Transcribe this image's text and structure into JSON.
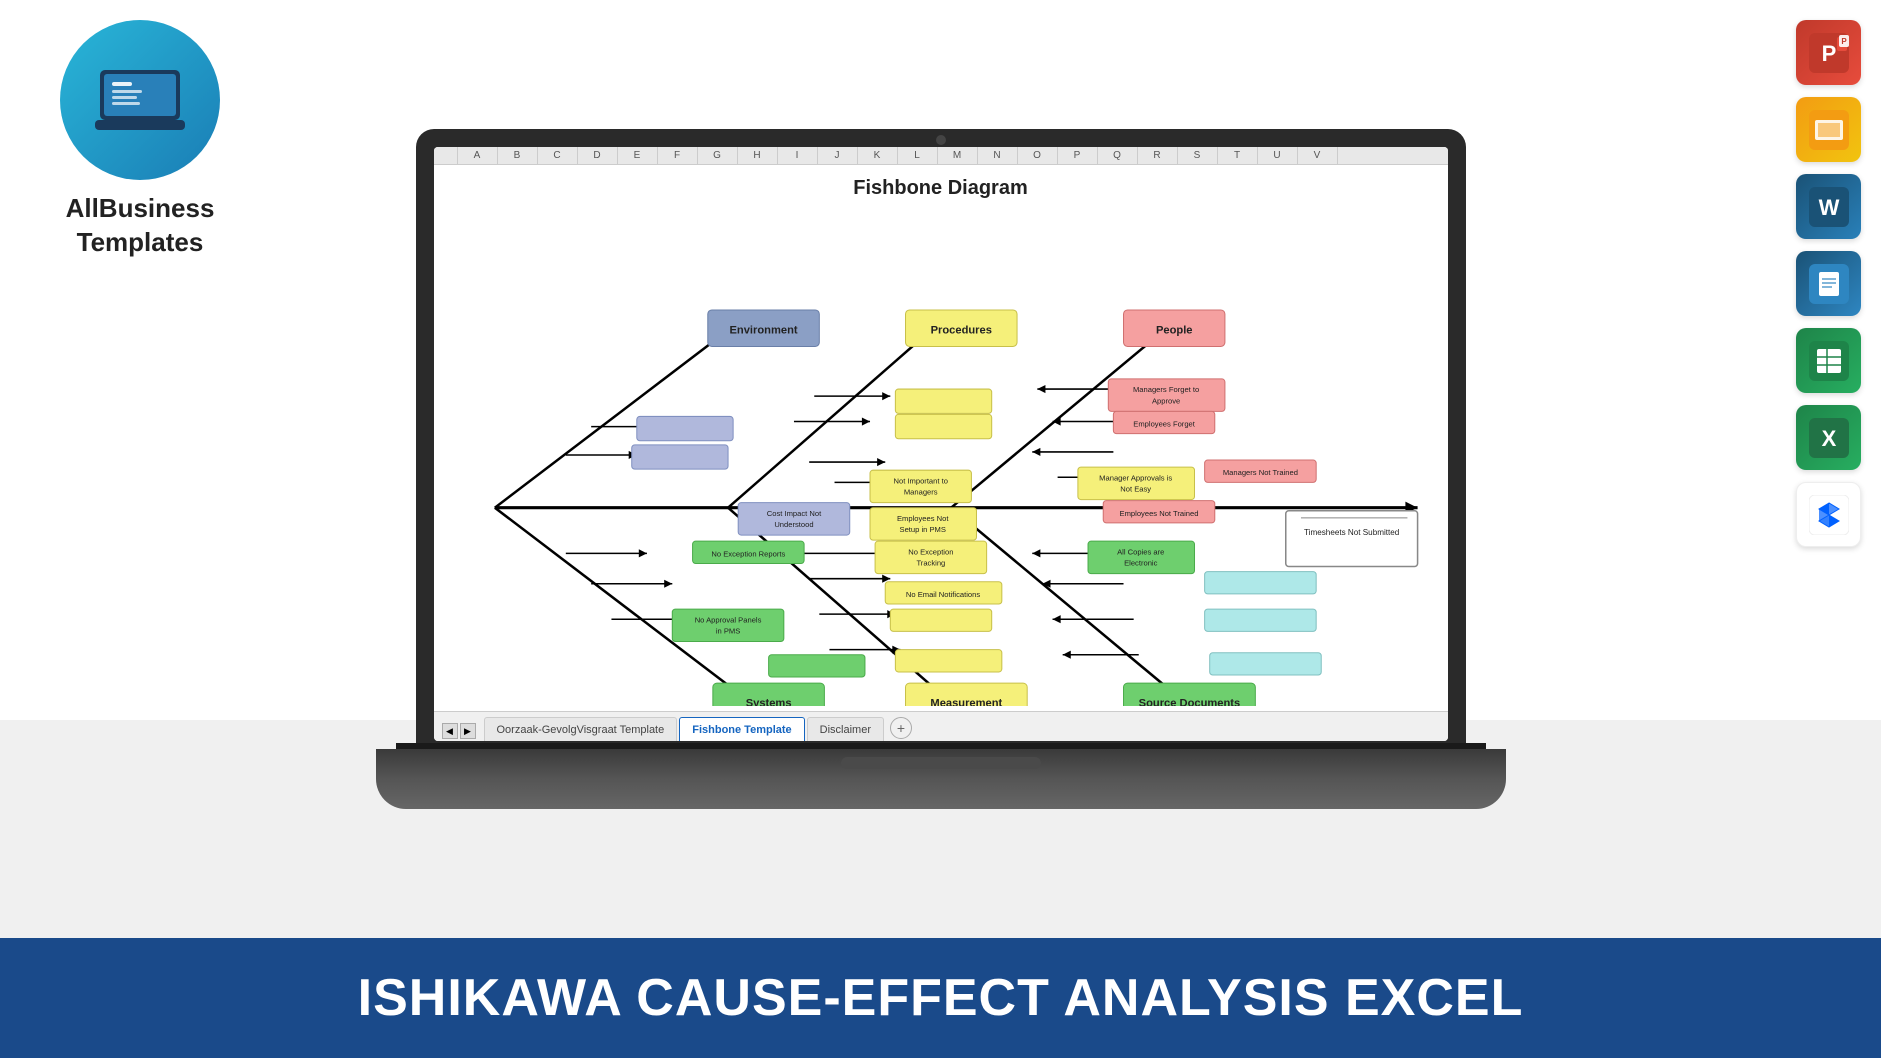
{
  "logo": {
    "brand_name": "AllBusiness\nTemplates",
    "brand_name_line1": "AllBusiness",
    "brand_name_line2": "Templates"
  },
  "bottom_banner": {
    "text": "ISHIKAWA CAUSE-EFFECT ANALYSIS  EXCEL"
  },
  "diagram": {
    "title": "Fishbone Diagram",
    "categories": {
      "environment": "Environment",
      "procedures": "Procedures",
      "people": "People",
      "systems": "Systems",
      "measurement": "Measurement",
      "source_documents": "Source Documents"
    },
    "boxes": {
      "managers_forget_approve": "Managers Forget to Approve",
      "employees_forget": "Employees Forget",
      "managers_not_trained": "Managers Not Trained",
      "manager_approvals_not_easy": "Manager Approvals is Not Easy",
      "employees_not_trained": "Employees Not Trained",
      "not_important_managers": "Not Important to Managers",
      "employees_not_setup_pms": "Employees Not Setup in PMS",
      "cost_impact_not_understood": "Cost Impact Not Understood",
      "no_exception_reports": "No Exception Reports",
      "no_exception_tracking": "No Exception Tracking",
      "no_email_notifications": "No Email Notifications",
      "all_copies_electronic": "All Copies are Electronic",
      "no_approval_panels_pms": "No Approval Panels in PMS",
      "timesheets_not_submitted": "Timesheets Not Submitted"
    }
  },
  "tabs": {
    "tab1": "Oorzaak-GevolgVisgraat Template",
    "tab2": "Fishbone Template",
    "tab3": "Disclaimer"
  },
  "col_headers": [
    "A",
    "B",
    "C",
    "D",
    "E",
    "F",
    "G",
    "H",
    "I",
    "J",
    "K",
    "L",
    "M",
    "N",
    "O",
    "P",
    "Q",
    "R",
    "S",
    "T",
    "U",
    "V"
  ],
  "right_icons": [
    {
      "name": "PowerPoint",
      "letter": "P",
      "type": "ppt"
    },
    {
      "name": "Google Slides",
      "letter": "▶",
      "type": "slides"
    },
    {
      "name": "Word",
      "letter": "W",
      "type": "word"
    },
    {
      "name": "Google Docs",
      "letter": "≡",
      "type": "docs"
    },
    {
      "name": "Google Sheets",
      "letter": "⊞",
      "type": "sheets"
    },
    {
      "name": "Excel",
      "letter": "X",
      "type": "excel"
    },
    {
      "name": "Dropbox",
      "letter": "◆",
      "type": "dropbox"
    }
  ]
}
